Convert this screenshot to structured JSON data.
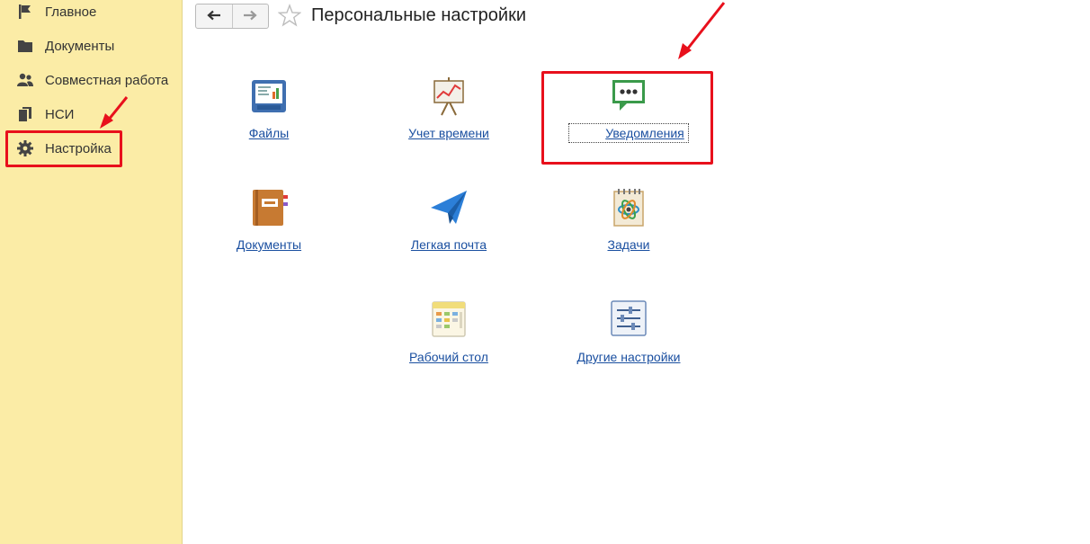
{
  "sidebar": {
    "items": [
      {
        "label": "Главное",
        "icon": "flag-icon"
      },
      {
        "label": "Документы",
        "icon": "folder-icon"
      },
      {
        "label": "Совместная работа",
        "icon": "users-icon"
      },
      {
        "label": "НСИ",
        "icon": "books-icon"
      },
      {
        "label": "Настройка",
        "icon": "gear-icon"
      }
    ],
    "active_index": 4
  },
  "header": {
    "back_icon": "arrow-left-icon",
    "forward_icon": "arrow-right-icon",
    "favorite_icon": "star-icon",
    "title": "Персональные настройки"
  },
  "tiles": [
    {
      "label": "Файлы",
      "icon": "files-icon"
    },
    {
      "label": "Учет времени",
      "icon": "time-tracking-icon"
    },
    {
      "label": "Уведомления",
      "icon": "notifications-icon"
    },
    {
      "label": "Документы",
      "icon": "documents-icon"
    },
    {
      "label": "Легкая почта",
      "icon": "paper-plane-icon"
    },
    {
      "label": "Задачи",
      "icon": "tasks-icon"
    },
    {
      "label": "Рабочий стол",
      "icon": "desktop-icon"
    },
    {
      "label": "Другие настройки",
      "icon": "sliders-icon"
    }
  ],
  "colors": {
    "sidebar_bg": "#fbeca6",
    "link": "#1a4fa0",
    "annotation_red": "#e8101c"
  }
}
